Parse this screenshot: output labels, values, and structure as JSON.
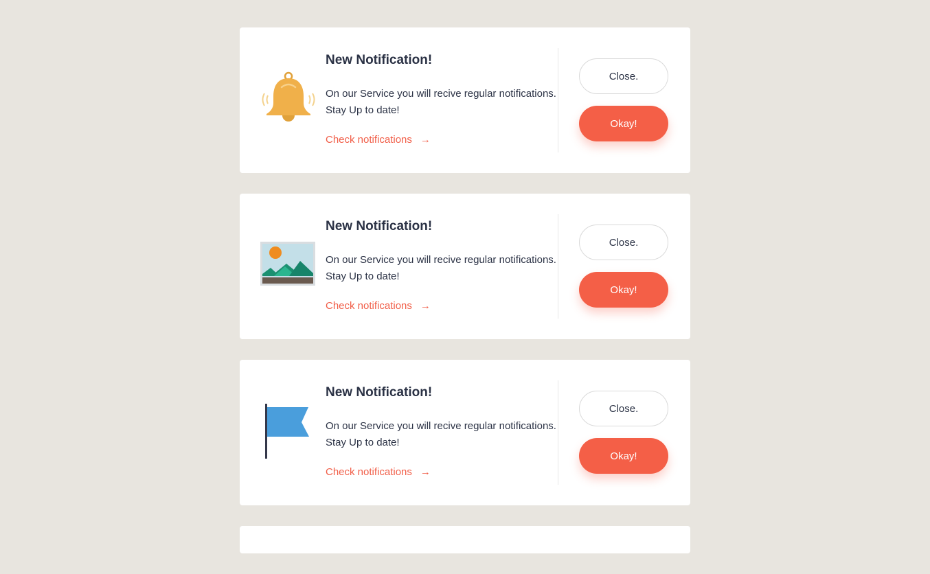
{
  "notifications": [
    {
      "icon": "bell-icon",
      "title": "New Notification!",
      "message_line1": "On our Service you will recive regular notifications.",
      "message_line2": "Stay Up to date!",
      "link_label": "Check notifications",
      "link_arrow": "→",
      "close_label": "Close.",
      "okay_label": "Okay!"
    },
    {
      "icon": "image-icon",
      "title": "New Notification!",
      "message_line1": "On our Service you will recive regular notifications.",
      "message_line2": "Stay Up to date!",
      "link_label": "Check notifications",
      "link_arrow": "→",
      "close_label": "Close.",
      "okay_label": "Okay!"
    },
    {
      "icon": "flag-icon",
      "title": "New Notification!",
      "message_line1": "On our Service you will recive regular notifications.",
      "message_line2": "Stay Up to date!",
      "link_label": "Check notifications",
      "link_arrow": "→",
      "close_label": "Close.",
      "okay_label": "Okay!"
    }
  ],
  "colors": {
    "background": "#e8e5df",
    "card": "#ffffff",
    "accent": "#f45f47",
    "text": "#2b3245",
    "bell": "#f0b04a",
    "flag": "#4a9edc"
  }
}
